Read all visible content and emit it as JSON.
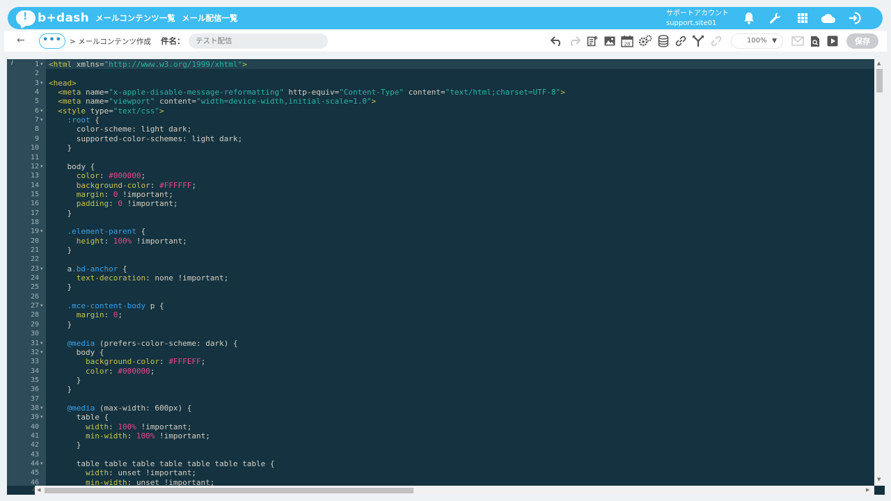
{
  "header": {
    "logo_text": "b+dash",
    "nav": [
      "メールコンテンツ一覧",
      "メール配信一覧"
    ],
    "account_label": "サポートアカウント",
    "account_id": "support.site01",
    "icons": [
      "bell-icon",
      "wrench-icon",
      "grid-icon",
      "cloud-icon",
      "logout-icon"
    ]
  },
  "toolbar": {
    "back_glyph": "←",
    "more_glyph": "•••",
    "breadcrumb": "> メールコンテンツ作成",
    "subject_label": "件名：",
    "subject_placeholder": "テスト配信",
    "zoom": "100%",
    "save_label": "保存"
  },
  "editor": {
    "first_line_marker": "i",
    "bottom_line_number": "4",
    "lines": [
      {
        "n": "1",
        "fold": true,
        "html": "<span class='t'>&lt;html</span> <span class='a'>xmlns</span>=<span class='s'>\"http://www.w3.org/1999/xhtml\"</span><span class='t'>&gt;</span>"
      },
      {
        "n": "2",
        "html": ""
      },
      {
        "n": "3",
        "fold": true,
        "html": "<span class='t'>&lt;head&gt;</span>"
      },
      {
        "n": "4",
        "html": "  <span class='t'>&lt;meta</span> <span class='a'>name</span>=<span class='s'>\"x-apple-disable-message-reformatting\"</span> <span class='a'>http-equiv</span>=<span class='s'>\"Content-Type\"</span> <span class='a'>content</span>=<span class='s'>\"text/html;charset=UTF-8\"</span><span class='t'>&gt;</span>"
      },
      {
        "n": "5",
        "html": "  <span class='t'>&lt;meta</span> <span class='a'>name</span>=<span class='s'>\"viewport\"</span> <span class='a'>content</span>=<span class='s'>\"width=device-width,initial-scale=1.0\"</span><span class='t'>&gt;</span>"
      },
      {
        "n": "6",
        "fold": true,
        "html": "  <span class='t'>&lt;style</span> <span class='a'>type</span>=<span class='s'>\"text/css\"</span><span class='t'>&gt;</span>"
      },
      {
        "n": "7",
        "fold": true,
        "html": "    <span class='c'>:root</span> {"
      },
      {
        "n": "8",
        "html": "      color-scheme: light dark;"
      },
      {
        "n": "9",
        "html": "      supported-color-schemes: light dark;"
      },
      {
        "n": "10",
        "html": "    }"
      },
      {
        "n": "11",
        "html": ""
      },
      {
        "n": "12",
        "fold": true,
        "html": "    body {"
      },
      {
        "n": "13",
        "html": "      <span class='p'>color</span>: <span class='v'>#000000</span>;"
      },
      {
        "n": "14",
        "html": "      <span class='p'>background-color</span>: <span class='v'>#FFFFFF</span>;"
      },
      {
        "n": "15",
        "html": "      <span class='p'>margin</span>: <span class='v'>0</span> !important;"
      },
      {
        "n": "16",
        "html": "      <span class='p'>padding</span>: <span class='v'>0</span> !important;"
      },
      {
        "n": "17",
        "html": "    }"
      },
      {
        "n": "18",
        "html": ""
      },
      {
        "n": "19",
        "fold": true,
        "html": "    <span class='c'>.element-parent</span> {"
      },
      {
        "n": "20",
        "html": "      <span class='p'>height</span>: <span class='v'>100%</span> !important;"
      },
      {
        "n": "21",
        "html": "    }"
      },
      {
        "n": "22",
        "html": ""
      },
      {
        "n": "23",
        "fold": true,
        "html": "    a<span class='c'>.bd-anchor</span> {"
      },
      {
        "n": "24",
        "html": "      <span class='p'>text-decoration</span>: none !important;"
      },
      {
        "n": "25",
        "html": "    }"
      },
      {
        "n": "26",
        "html": ""
      },
      {
        "n": "27",
        "fold": true,
        "html": "    <span class='c'>.mce-content-body</span> p {"
      },
      {
        "n": "28",
        "html": "      <span class='p'>margin</span>: <span class='v'>0</span>;"
      },
      {
        "n": "29",
        "html": "    }"
      },
      {
        "n": "30",
        "html": ""
      },
      {
        "n": "31",
        "fold": true,
        "html": "    <span class='c'>@media</span> (prefers-color-scheme: dark) {"
      },
      {
        "n": "32",
        "fold": true,
        "html": "      body {"
      },
      {
        "n": "33",
        "html": "        <span class='p'>background-color</span>: <span class='v'>#FFFEFF</span>;"
      },
      {
        "n": "34",
        "html": "        <span class='p'>color</span>: <span class='v'>#000000</span>;"
      },
      {
        "n": "35",
        "html": "      }"
      },
      {
        "n": "36",
        "html": "    }"
      },
      {
        "n": "37",
        "html": ""
      },
      {
        "n": "38",
        "fold": true,
        "html": "    <span class='c'>@media</span> (max-width: 600px) {"
      },
      {
        "n": "39",
        "fold": true,
        "html": "      table {"
      },
      {
        "n": "40",
        "html": "        <span class='p'>width</span>: <span class='v'>100%</span> !important;"
      },
      {
        "n": "41",
        "html": "        <span class='p'>min-width</span>: <span class='v'>100%</span> !important;"
      },
      {
        "n": "42",
        "html": "      }"
      },
      {
        "n": "43",
        "html": ""
      },
      {
        "n": "44",
        "fold": true,
        "html": "      table table table table table table table {"
      },
      {
        "n": "45",
        "html": "        <span class='p'>width</span>: unset !important;"
      },
      {
        "n": "46",
        "html": "        <span class='p'>min-width</span>: unset !important;"
      }
    ]
  }
}
